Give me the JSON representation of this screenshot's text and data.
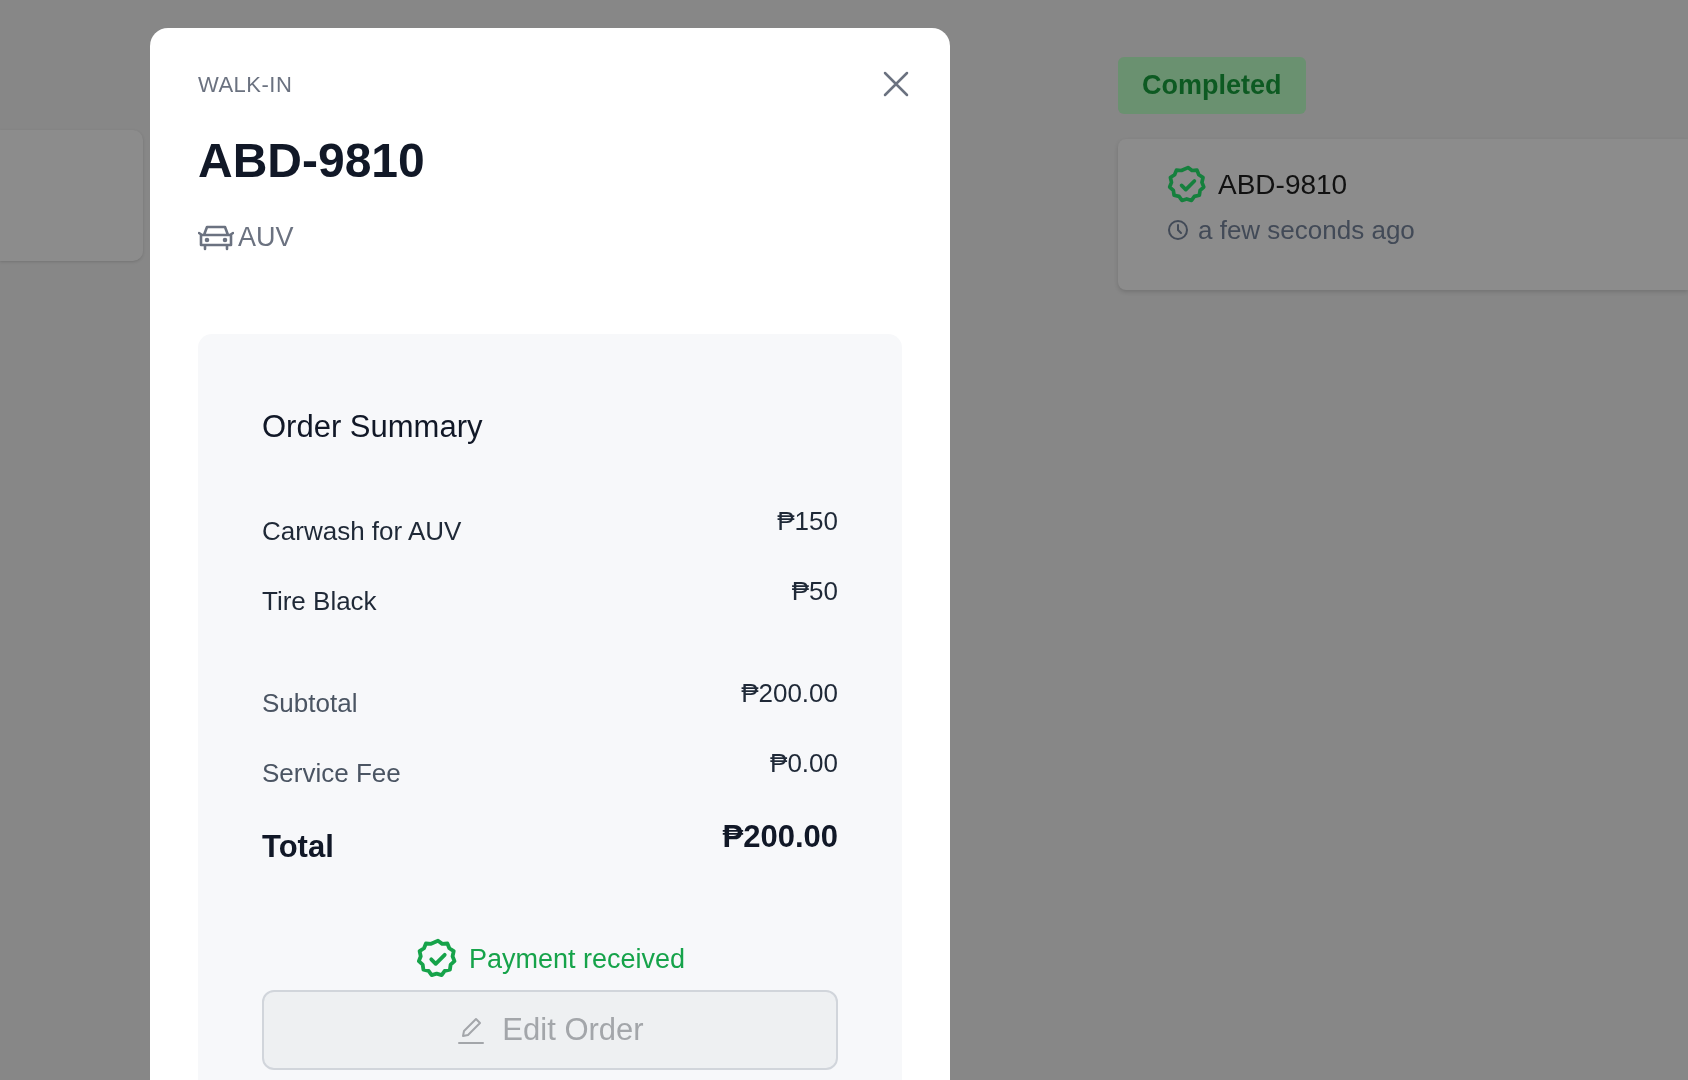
{
  "board": {
    "left_card": {
      "kind": "card"
    },
    "column": {
      "status": "Completed",
      "cards": [
        {
          "plate": "ABD-9810",
          "paid": true,
          "time": "a few seconds ago"
        }
      ]
    }
  },
  "modal": {
    "order_type": "WALK-IN",
    "plate": "ABD-9810",
    "vehicle": "AUV",
    "summary": {
      "title": "Order Summary",
      "items": [
        {
          "name": "Carwash for AUV",
          "price": "₱150"
        },
        {
          "name": "Tire Black",
          "price": "₱50"
        }
      ],
      "subtotal": {
        "label": "Subtotal",
        "value": "₱200.00"
      },
      "service_fee": {
        "label": "Service Fee",
        "value": "₱0.00"
      },
      "total": {
        "label": "Total",
        "value": "₱200.00"
      },
      "payment": {
        "text": "Payment received",
        "paid": true
      },
      "edit_button": {
        "label": "Edit Order",
        "disabled": true
      }
    }
  }
}
